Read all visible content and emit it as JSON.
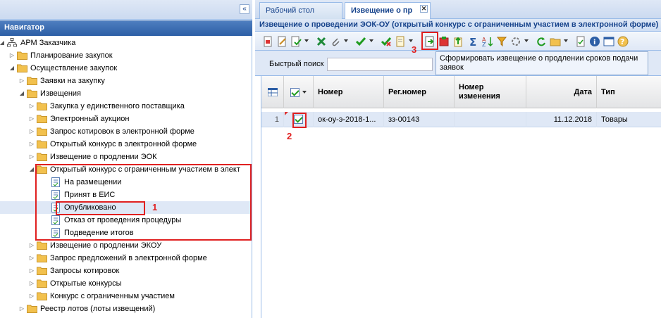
{
  "navigator": {
    "collapse_icon": "«",
    "title": "Навигатор",
    "tree": [
      {
        "label": "АРМ Заказчика",
        "level": 0,
        "expanded": true,
        "icon": "sitemap-icon"
      },
      {
        "label": "Планирование закупок",
        "level": 1,
        "expanded": false,
        "icon": "folder-icon"
      },
      {
        "label": "Осуществление закупок",
        "level": 1,
        "expanded": true,
        "icon": "folder-icon"
      },
      {
        "label": "Заявки на закупку",
        "level": 2,
        "expanded": false,
        "icon": "folder-icon"
      },
      {
        "label": "Извещения",
        "level": 2,
        "expanded": true,
        "icon": "folder-icon"
      },
      {
        "label": "Закупка у единственного поставщика",
        "level": 3,
        "expanded": false,
        "icon": "folder-icon"
      },
      {
        "label": "Электронный аукцион",
        "level": 3,
        "expanded": false,
        "icon": "folder-icon"
      },
      {
        "label": "Запрос котировок в электронной форме",
        "level": 3,
        "expanded": false,
        "icon": "folder-icon"
      },
      {
        "label": "Открытый конкурс в электронной форме",
        "level": 3,
        "expanded": false,
        "icon": "folder-icon"
      },
      {
        "label": "Извещение о продлении ЭОК",
        "level": 3,
        "expanded": false,
        "icon": "folder-icon"
      },
      {
        "label": "Открытый конкурс с ограниченным участием в элект",
        "level": 3,
        "expanded": true,
        "icon": "folder-icon"
      },
      {
        "label": "На размещении",
        "level": 4,
        "leaf": true,
        "icon": "document-icon"
      },
      {
        "label": "Принят в ЕИС",
        "level": 4,
        "leaf": true,
        "icon": "document-icon"
      },
      {
        "label": "Опубликовано",
        "level": 4,
        "leaf": true,
        "icon": "document-icon",
        "selected": true
      },
      {
        "label": "Отказ от проведения процедуры",
        "level": 4,
        "leaf": true,
        "icon": "document-icon"
      },
      {
        "label": "Подведение итогов",
        "level": 4,
        "leaf": true,
        "icon": "document-icon"
      },
      {
        "label": "Извещение о продлении ЭКОУ",
        "level": 3,
        "expanded": false,
        "icon": "folder-icon"
      },
      {
        "label": "Запрос предложений в электронной форме",
        "level": 3,
        "expanded": false,
        "icon": "folder-icon"
      },
      {
        "label": "Запросы котировок",
        "level": 3,
        "expanded": false,
        "icon": "folder-icon"
      },
      {
        "label": "Открытые конкурсы",
        "level": 3,
        "expanded": false,
        "icon": "folder-icon"
      },
      {
        "label": "Конкурс с ограниченным участием",
        "level": 3,
        "expanded": false,
        "icon": "folder-icon"
      },
      {
        "label": "Реестр лотов (лоты извещений)",
        "level": 2,
        "expanded": false,
        "icon": "folder-icon"
      }
    ]
  },
  "annotations": {
    "n1": "1",
    "n2": "2",
    "n3": "3"
  },
  "tabs": [
    {
      "label": "Рабочий стол"
    },
    {
      "label": "Извещение о пр",
      "close": "✕"
    }
  ],
  "panel": {
    "title": "Извещение о проведении ЭОК-ОУ (открытый конкурс с ограниченным участием в электронной форме)"
  },
  "toolbar": {
    "tooltip": "Сформировать извещение о продлении сроков подачи заявок"
  },
  "quick_search": {
    "label": "Быстрый поиск",
    "value": ""
  },
  "grid": {
    "columns": [
      "Номер",
      "Рег.номер",
      "Номер изменения",
      "Дата",
      "Тип"
    ],
    "rows": [
      {
        "index": "1",
        "checked": true,
        "number": "ок-оу-э-2018-1...",
        "reg_number": "зз-00143",
        "change_number": "",
        "date": "11.12.2018",
        "type": "Товары"
      }
    ]
  },
  "colors": {
    "header_blue": "#2d5fa6",
    "panel_bg": "#dfe8f6",
    "annotation_red": "#e02020",
    "folder": "#f2c14e"
  }
}
